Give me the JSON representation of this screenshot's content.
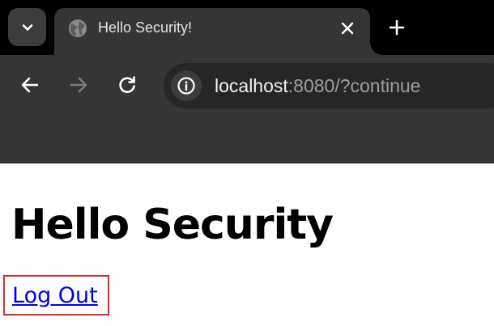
{
  "browser": {
    "tab": {
      "title": "Hello Security!",
      "favicon": "globe-icon"
    },
    "toolbar": {
      "back_icon": "back-arrow-icon",
      "forward_icon": "forward-arrow-icon",
      "reload_icon": "reload-icon"
    },
    "omnibox": {
      "host": "localhost",
      "rest": ":8080/?continue",
      "site_info_icon": "info-icon"
    },
    "colors": {
      "tabstrip": "#000000",
      "toolbar": "#353535",
      "omnibox": "#262626",
      "highlight_box": "#d92b2b",
      "link": "#0000ee"
    }
  },
  "page": {
    "heading": "Hello Security",
    "logout_link": "Log Out"
  }
}
